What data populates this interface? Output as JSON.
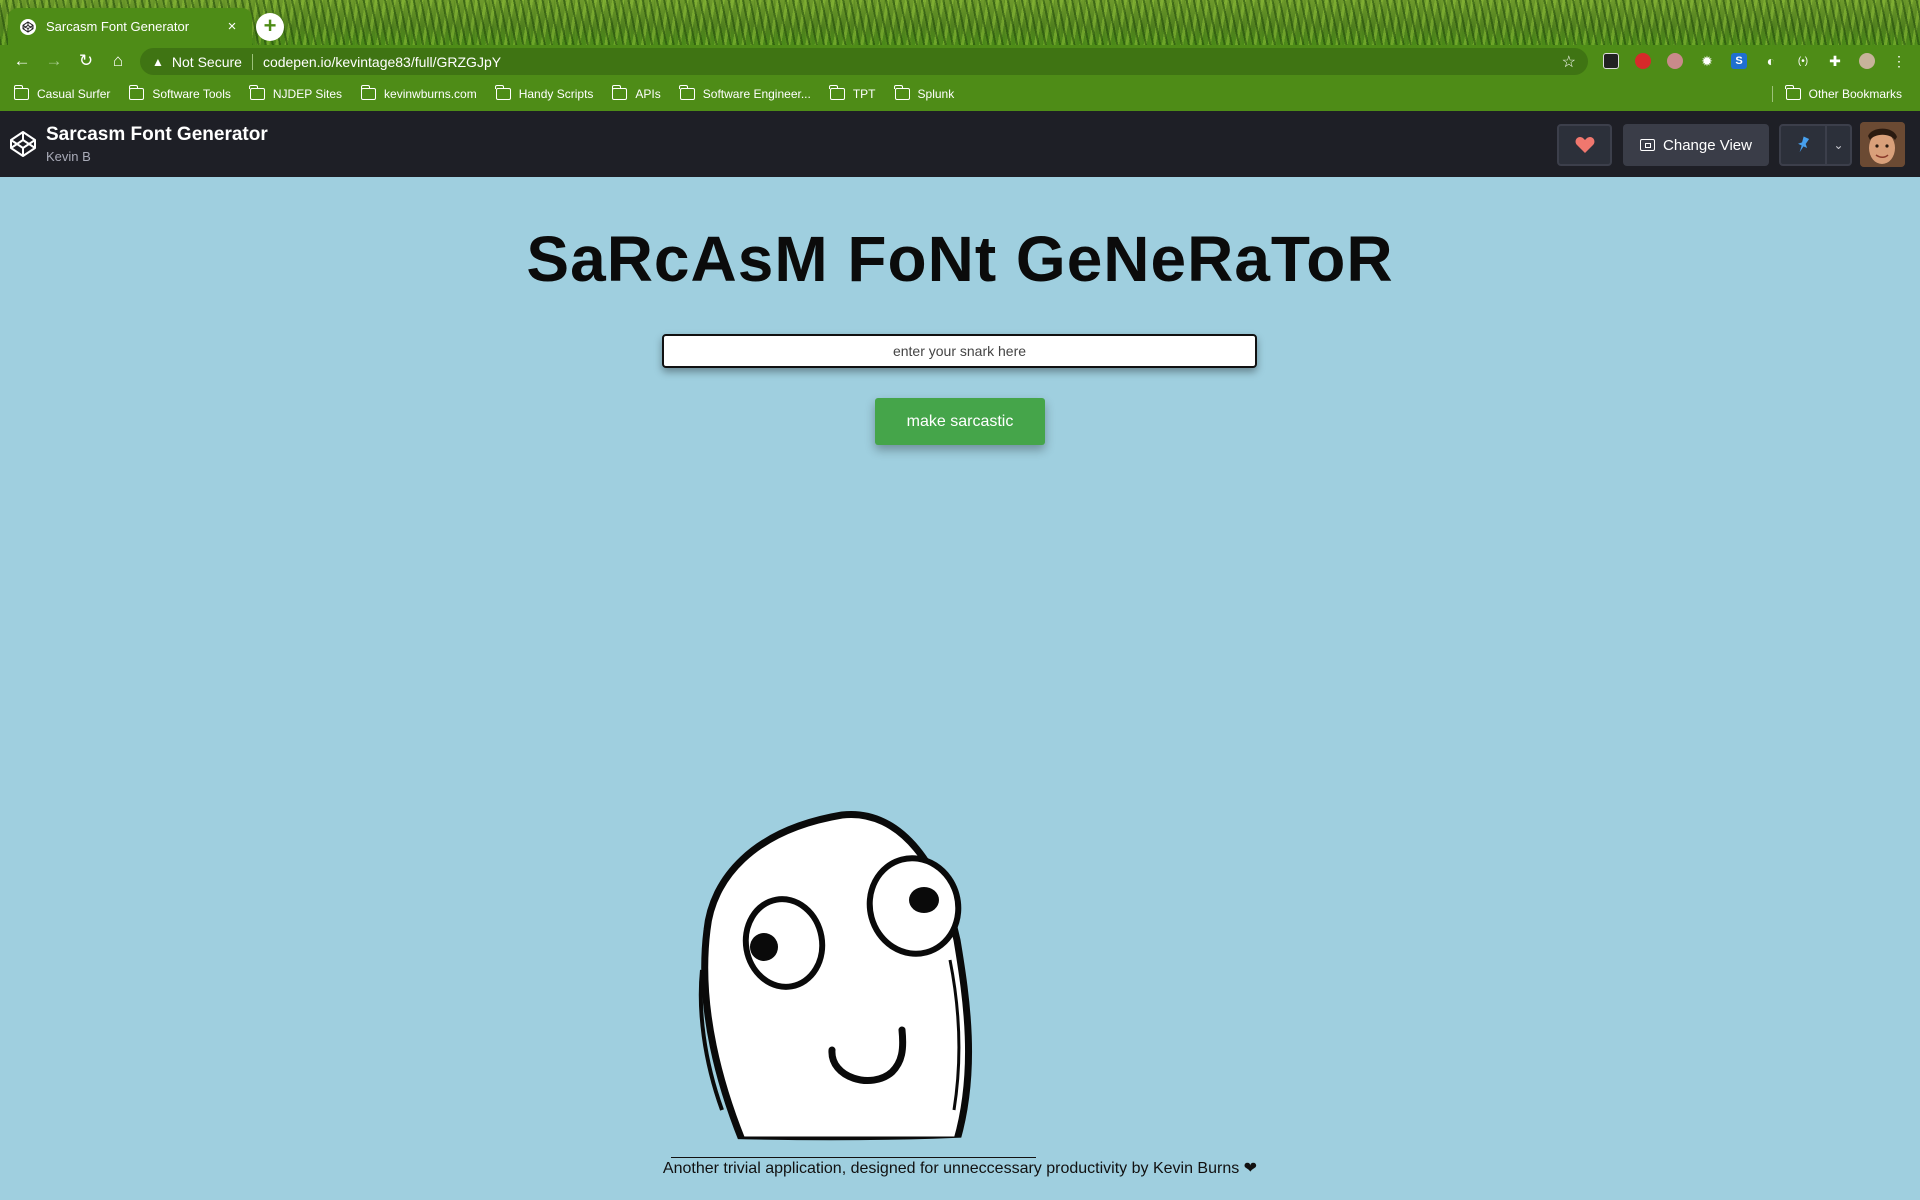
{
  "browser": {
    "tab": {
      "title": "Sarcasm Font Generator",
      "close_glyph": "×"
    },
    "new_tab_glyph": "+",
    "nav": {
      "back": "←",
      "forward": "→",
      "reload": "↻",
      "home": "⌂"
    },
    "omnibox": {
      "security_label": "Not Secure",
      "url": "codepen.io/kevintage83/full/GRZGJpY"
    },
    "bookmarks": [
      "Casual Surfer",
      "Software Tools",
      "NJDEP Sites",
      "kevinwburns.com",
      "Handy Scripts",
      "APIs",
      "Software Engineer...",
      "TPT",
      "Splunk"
    ],
    "other_bookmarks": "Other Bookmarks",
    "extension_icons": [
      "eyes-icon",
      "stop-icon",
      "elephant-icon",
      "gear-icon",
      "s-icon",
      "moon-icon",
      "brackets-icon",
      "puzzle-icon",
      "profile-icon",
      "menu-icon"
    ]
  },
  "codepen": {
    "pen_title": "Sarcasm Font Generator",
    "author": "Kevin B",
    "change_view_label": "Change View",
    "heart_color": "#f0776e",
    "pin_color": "#47a0ee"
  },
  "pen": {
    "heading": "SaRcAsM FoNt GeNeRaToR",
    "input_placeholder": "enter your snark here",
    "button_label": "make sarcastic",
    "footer": "Another trivial application, designed for unneccessary productivity by Kevin Burns ❤",
    "background_color": "#9fcfdf",
    "button_color": "#45a54a"
  }
}
